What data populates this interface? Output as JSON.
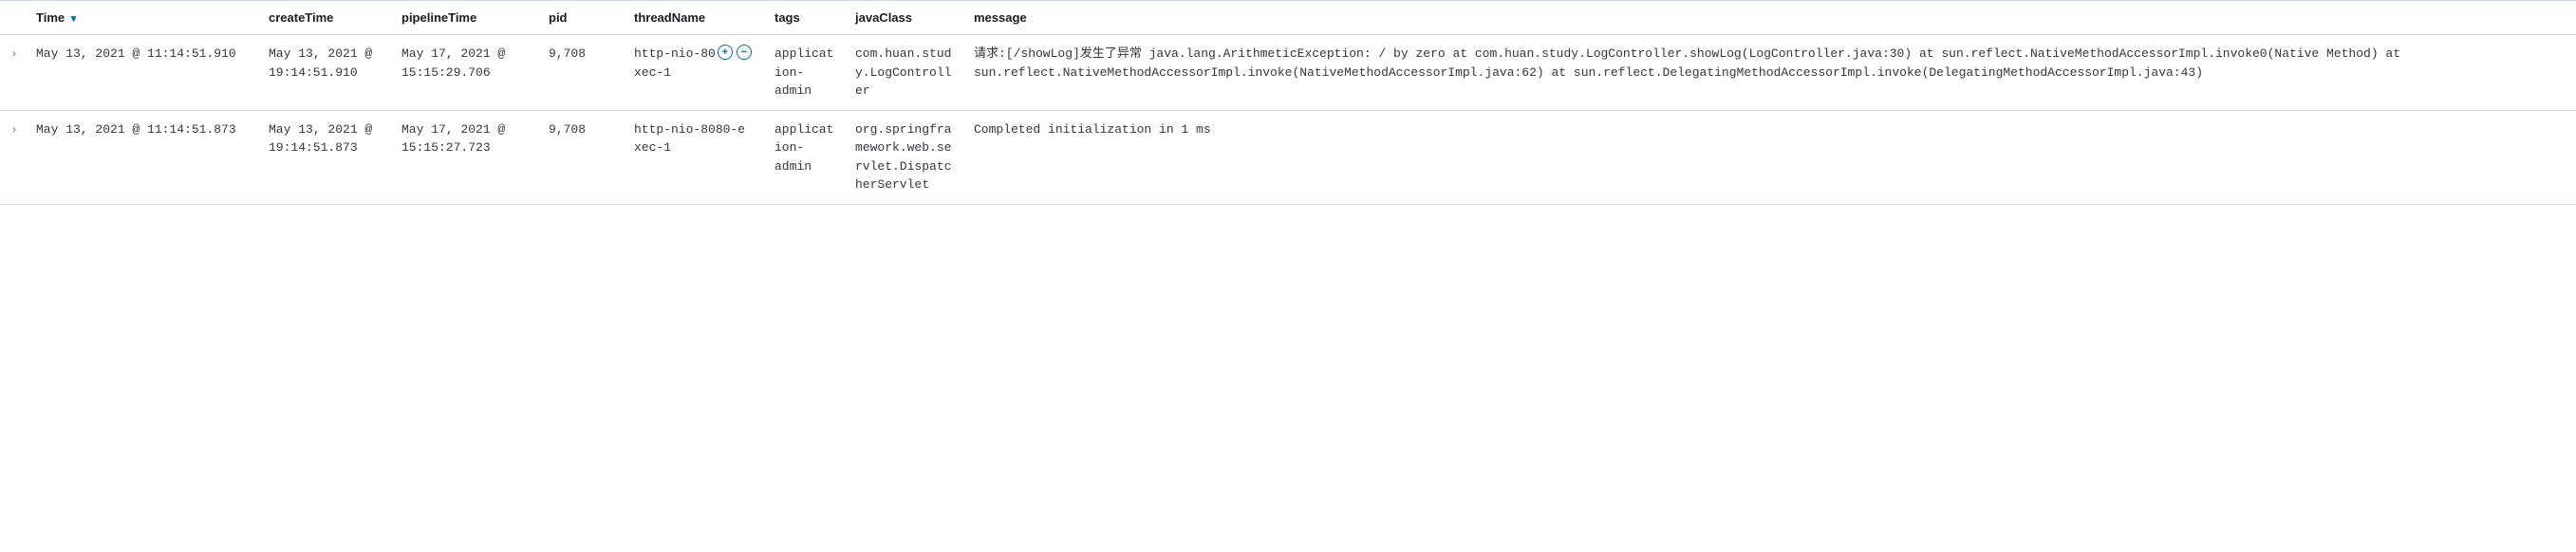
{
  "columns": {
    "time": "Time",
    "createTime": "createTime",
    "pipelineTime": "pipelineTime",
    "pid": "pid",
    "threadName": "threadName",
    "tags": "tags",
    "javaClass": "javaClass",
    "message": "message"
  },
  "sort_indicator": "▾",
  "expand_glyph": "›",
  "plus_glyph": "+",
  "minus_glyph": "−",
  "rows": [
    {
      "time": "May 13, 2021 @ 11:14:51.910",
      "createTime": "May 13, 2021 @ 19:14:51.910",
      "pipelineTime": "May 17, 2021 @ 15:15:29.706",
      "pid": "9,708",
      "threadName_a": "http-nio-80",
      "threadName_b": "xec-1",
      "has_filter_icons": true,
      "tags": "application-admin",
      "javaClass": "com.huan.study.LogController",
      "message": "请求:[/showLog]发生了异常 java.lang.ArithmeticException: / by zero at com.huan.study.LogController.showLog(LogController.java:30) at sun.reflect.NativeMethodAccessorImpl.invoke0(Native Method) at sun.reflect.NativeMethodAccessorImpl.invoke(NativeMethodAccessorImpl.java:62) at sun.reflect.DelegatingMethodAccessorImpl.invoke(DelegatingMethodAccessorImpl.java:43)"
    },
    {
      "time": "May 13, 2021 @ 11:14:51.873",
      "createTime": "May 13, 2021 @ 19:14:51.873",
      "pipelineTime": "May 17, 2021 @ 15:15:27.723",
      "pid": "9,708",
      "threadName_a": "http-nio-8080-e",
      "threadName_b": "xec-1",
      "has_filter_icons": false,
      "tags": "application-admin",
      "javaClass": "org.springframework.web.servlet.DispatcherServlet",
      "message": "Completed initialization in 1 ms"
    }
  ]
}
